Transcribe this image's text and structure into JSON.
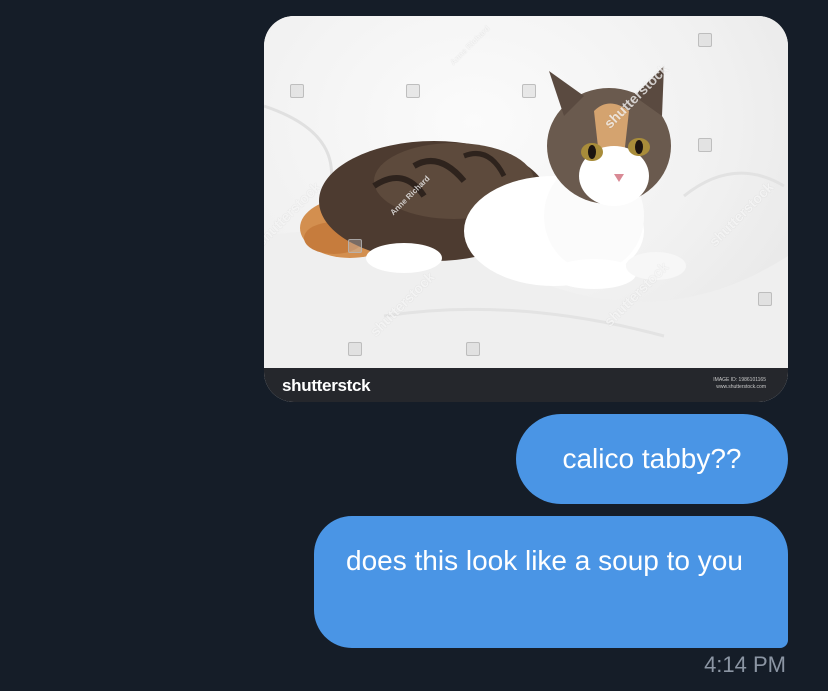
{
  "conversation": {
    "image_attachment": {
      "description_icon": "photo-icon",
      "watermark_text": "shutterstock",
      "photographer_text": "Anne Richard",
      "footer_logo": "shutterstck",
      "image_id_label": "IMAGE ID: 1986101165",
      "site": "www.shutterstock.com"
    },
    "messages": [
      {
        "text": "calico tabby??"
      },
      {
        "text": "does this look like a soup to you"
      }
    ],
    "timestamp": "4:14 PM"
  },
  "colors": {
    "background": "#151d28",
    "bubble": "#4a95e5",
    "timestamp": "#8b95a3",
    "footer_bar": "#25272c"
  }
}
